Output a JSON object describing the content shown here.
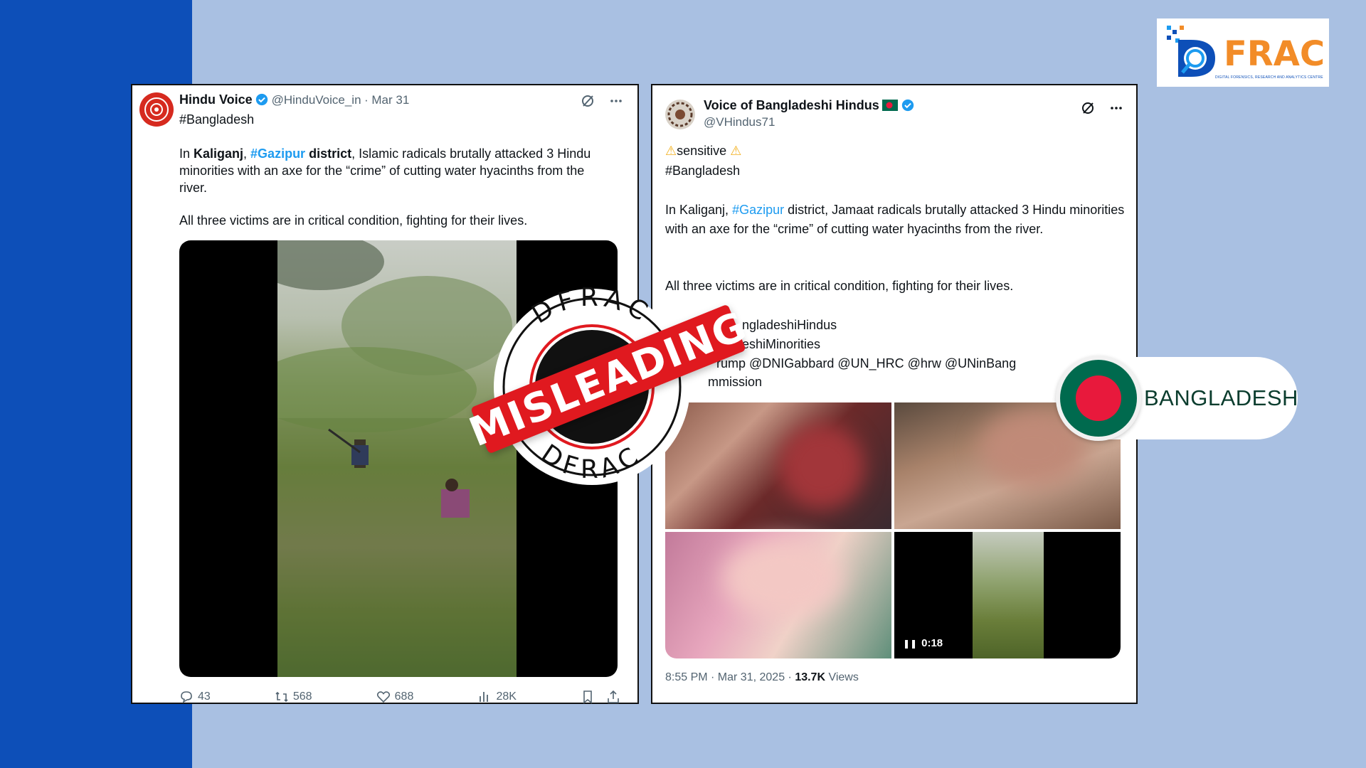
{
  "brand": {
    "logo_text": "FRAC",
    "logo_subtitle": "DIGITAL FORENSICS, RESEARCH AND ANALYTICS CENTRE"
  },
  "tweet1": {
    "name": "Hindu Voice",
    "handle": "@HinduVoice_in",
    "date": "· Mar 31",
    "hashtag": "#Bangladesh",
    "para1_pre": "In ",
    "para1_place": "Kaliganj",
    "para1_comma": ", ",
    "para1_tag": "#Gazipur",
    "para1_district": " district",
    "para1_post": ", Islamic radicals brutally attacked 3 Hindu minorities with an axe for the “crime” of cutting water hyacinths from the river.",
    "para2": "All three victims are in critical condition, fighting for their lives.",
    "replies": "43",
    "reposts": "568",
    "likes": "688",
    "views": "28K"
  },
  "tweet2": {
    "name": "Voice of Bangladeshi Hindus",
    "handle": "@VHindus71",
    "sensitive": "sensitive",
    "hashtag": "#Bangladesh",
    "para1_pre": "In Kaliganj, ",
    "para1_tag": "#Gazipur",
    "para1_post": " district, Jamaat  radicals brutally attacked 3 Hindu minorities with an axe for the “crime” of cutting water hyacinths from the river.",
    "para2": "All three victims are in critical condition, fighting for their lives.",
    "tags_line1": "ngladeshiHindus",
    "tags_line2": "eshiMinorities",
    "tags_line3": "rump @DNIGabbard @UN_HRC @hrw @UNinBangla",
    "tags_line4": "mmission",
    "video_time": "0:18",
    "timestamp": "8:55 PM · Mar 31, 2025 · ",
    "views_count": "13.7K",
    "views_label": " Views"
  },
  "stamp": {
    "ring_text_top": "DFRAC",
    "ring_text_bottom": "DFRAC",
    "label": "MISLEADING",
    "color": "#e0191f"
  },
  "country": {
    "name": "BANGLADESH",
    "flag_green": "#006a4e",
    "flag_red": "#e8193c"
  },
  "colors": {
    "background": "#a9c0e2",
    "band": "#0d4fb8",
    "link": "#1d9bf0"
  }
}
